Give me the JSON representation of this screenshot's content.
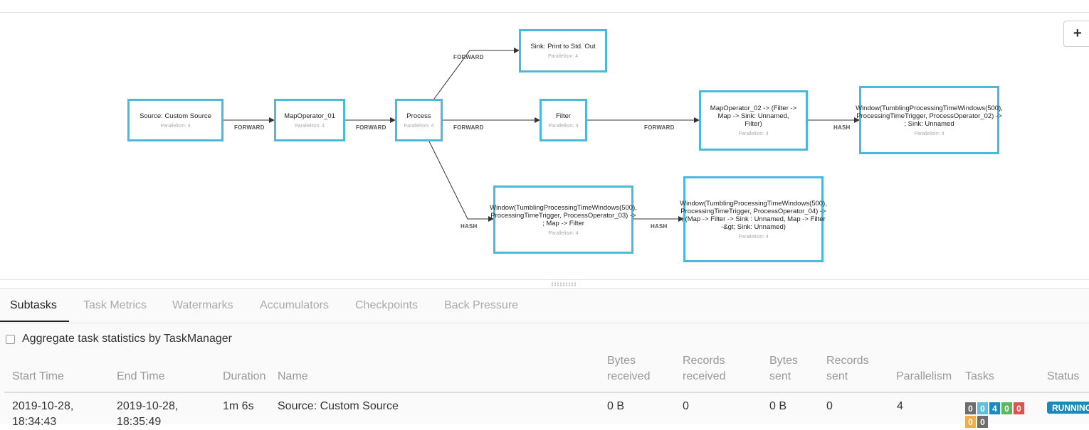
{
  "graph": {
    "zoom_in_label": "+",
    "nodes": [
      {
        "id": "source",
        "name": "Source: Custom Source",
        "parallelism": "Parallelism: 4"
      },
      {
        "id": "map01",
        "name": "MapOperator_01",
        "parallelism": "Parallelism: 4"
      },
      {
        "id": "process",
        "name": "Process",
        "parallelism": "Parallelism: 4"
      },
      {
        "id": "sink_print",
        "name": "Sink: Print to Std. Out",
        "parallelism": "Parallelism: 4"
      },
      {
        "id": "filter",
        "name": "Filter",
        "parallelism": "Parallelism: 4"
      },
      {
        "id": "map02",
        "name": "MapOperator_02 -> (Filter -> Map -> Sink: Unnamed, Filter)",
        "parallelism": "Parallelism: 4"
      },
      {
        "id": "window02",
        "name": "Window(TumblingProcessingTimeWindows(500), ProcessingTimeTrigger, ProcessOperator_02) -> ; Sink: Unnamed",
        "parallelism": "Parallelism: 4"
      },
      {
        "id": "window03",
        "name": "Window(TumblingProcessingTimeWindows(500), ProcessingTimeTrigger, ProcessOperator_03) -> ; Map -> Filter",
        "parallelism": "Parallelism: 4"
      },
      {
        "id": "window04",
        "name": "Window(TumblingProcessingTimeWindows(500), ProcessingTimeTrigger, ProcessOperator_04) -> ; (Map -> Filter -> Sink : Unnamed, Map -> Filter -&gt; Sink: Unnamed)",
        "parallelism": "Parallelism: 4"
      }
    ],
    "edges": [
      {
        "from": "source",
        "to": "map01",
        "label": "FORWARD"
      },
      {
        "from": "map01",
        "to": "process",
        "label": "FORWARD"
      },
      {
        "from": "process",
        "to": "sink_print",
        "label": "FORWARD"
      },
      {
        "from": "process",
        "to": "filter",
        "label": "FORWARD"
      },
      {
        "from": "filter",
        "to": "map02",
        "label": "FORWARD"
      },
      {
        "from": "map02",
        "to": "window02",
        "label": "HASH"
      },
      {
        "from": "process",
        "to": "window03",
        "label": "HASH"
      },
      {
        "from": "window03",
        "to": "window04",
        "label": "HASH"
      }
    ]
  },
  "tabs": [
    {
      "label": "Subtasks",
      "active": true
    },
    {
      "label": "Task Metrics",
      "active": false
    },
    {
      "label": "Watermarks",
      "active": false
    },
    {
      "label": "Accumulators",
      "active": false
    },
    {
      "label": "Checkpoints",
      "active": false
    },
    {
      "label": "Back Pressure",
      "active": false
    }
  ],
  "aggregate_checkbox": {
    "label": "Aggregate task statistics by TaskManager",
    "checked": false
  },
  "table": {
    "headers": {
      "start_time": "Start Time",
      "end_time": "End Time",
      "duration": "Duration",
      "name": "Name",
      "bytes_received": [
        "Bytes",
        "received"
      ],
      "records_received": [
        "Records",
        "received"
      ],
      "bytes_sent": [
        "Bytes",
        "sent"
      ],
      "records_sent": [
        "Records",
        "sent"
      ],
      "parallelism": "Parallelism",
      "tasks": "Tasks",
      "status": "Status"
    },
    "rows": [
      {
        "start_time": [
          "2019-10-28,",
          "18:34:43"
        ],
        "end_time": [
          "2019-10-28,",
          "18:35:49"
        ],
        "duration": "1m 6s",
        "name": "Source: Custom Source",
        "bytes_received": "0 B",
        "records_received": "0",
        "bytes_sent": "0 B",
        "records_sent": "0",
        "parallelism": "4",
        "tasks": [
          {
            "value": "0",
            "color": "#6d6d6d"
          },
          {
            "value": "0",
            "color": "#5bc0de"
          },
          {
            "value": "4",
            "color": "#1a8abd"
          },
          {
            "value": "0",
            "color": "#5cb85c"
          },
          {
            "value": "0",
            "color": "#d9534f"
          },
          {
            "value": "0",
            "color": "#f0ad4e"
          },
          {
            "value": "0",
            "color": "#6d6d6d"
          }
        ],
        "status": "RUNNING"
      }
    ]
  }
}
